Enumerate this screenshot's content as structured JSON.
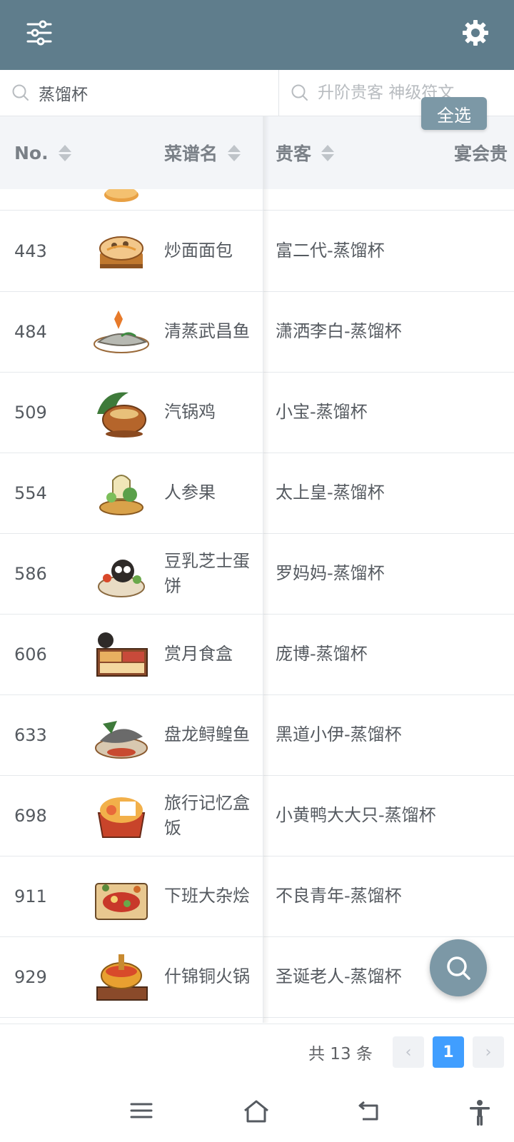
{
  "topbar": {
    "filter_icon": "sliders-icon",
    "settings_icon": "gear-icon",
    "color": "#5f7d8c"
  },
  "search": {
    "recipe_value": "蒸馏杯",
    "guest_placeholder": "升阶贵客 神级符文",
    "select_all_label": "全选"
  },
  "table": {
    "headers": {
      "no": "No.",
      "name": "菜谱名",
      "guest": "贵客",
      "banquet": "宴会贵"
    },
    "rows": [
      {
        "no": "443",
        "name": "炒面面包",
        "guest": "富二代-蒸馏杯"
      },
      {
        "no": "484",
        "name": "清蒸武昌鱼",
        "guest": "潇洒李白-蒸馏杯"
      },
      {
        "no": "509",
        "name": "汽锅鸡",
        "guest": "小宝-蒸馏杯"
      },
      {
        "no": "554",
        "name": "人参果",
        "guest": "太上皇-蒸馏杯"
      },
      {
        "no": "586",
        "name": "豆乳芝士蛋饼",
        "guest": "罗妈妈-蒸馏杯"
      },
      {
        "no": "606",
        "name": "赏月食盒",
        "guest": "庞博-蒸馏杯"
      },
      {
        "no": "633",
        "name": "盘龙鲟鳇鱼",
        "guest": "黑道小伊-蒸馏杯"
      },
      {
        "no": "698",
        "name": "旅行记忆盒饭",
        "guest": "小黄鸭大大只-蒸馏杯"
      },
      {
        "no": "911",
        "name": "下班大杂烩",
        "guest": "不良青年-蒸馏杯"
      },
      {
        "no": "929",
        "name": "什锦铜火锅",
        "guest": "圣诞老人-蒸馏杯"
      }
    ]
  },
  "pagination": {
    "total_text": "共 13 条",
    "prev": "‹",
    "current_page": "1",
    "next": "›",
    "active_color": "#409eff"
  },
  "navbar": {
    "menu_icon": "menu-icon",
    "home_icon": "home-icon",
    "back_icon": "back-icon",
    "accessibility_icon": "accessibility-icon"
  }
}
